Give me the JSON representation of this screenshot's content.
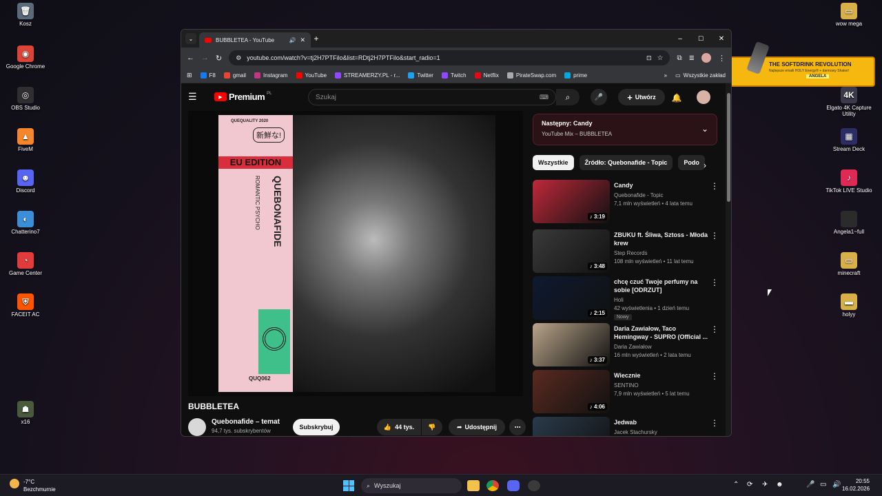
{
  "desktop": {
    "left_icons": [
      {
        "label": "Kosz",
        "color": "#5b6b7a",
        "glyph": "🗑"
      },
      {
        "label": "Google Chrome",
        "color": "#db4437",
        "glyph": "◉"
      },
      {
        "label": "OBS Studio",
        "color": "#302e31",
        "glyph": "◎"
      },
      {
        "label": "FiveM",
        "color": "#f5862b",
        "glyph": "▲"
      },
      {
        "label": "Discord",
        "color": "#5865f2",
        "glyph": "☻"
      },
      {
        "label": "Chatterino7",
        "color": "#3a8fd8",
        "glyph": "◐"
      },
      {
        "label": "Game Center",
        "color": "#e23b3b",
        "glyph": "◔"
      },
      {
        "label": "FACEIT AC",
        "color": "#ff5500",
        "glyph": "⛨"
      },
      {
        "label": "x16",
        "color": "#4a5a3c",
        "glyph": "☗"
      }
    ],
    "right_icons": [
      {
        "label": "wow mega",
        "color": "#d8b04a",
        "glyph": "▭"
      },
      {
        "label": "Elgato 4K Capture Utility",
        "color": "#3a3a4a",
        "glyph": "4K"
      },
      {
        "label": "Stream Deck",
        "color": "#2d2d66",
        "glyph": "▦"
      },
      {
        "label": "TikTok LIVE Studio",
        "color": "#e02a56",
        "glyph": "♪"
      },
      {
        "label": "Angela1~full",
        "color": "#2b2b2b",
        "glyph": ""
      },
      {
        "label": "minecraft",
        "color": "#d8b04a",
        "glyph": "▭"
      },
      {
        "label": "holyy",
        "color": "#d8b04a",
        "glyph": "▬"
      }
    ],
    "promo": {
      "title": "THE SOFTDRINK REVOLUTION",
      "subtitle": "Najlepsze emaili HOLY Energy® + darmowy Shaker!",
      "name": "ANGELA"
    }
  },
  "browser": {
    "tab_title": "BUBBLETEA - YouTube",
    "url": "youtube.com/watch?v=tj2H7PTFilo&list=RDtj2H7PTFilo&start_radio=1",
    "bookmarks": [
      {
        "label": "F8",
        "color": "#1877f2"
      },
      {
        "label": "gmail",
        "color": "#ea4335"
      },
      {
        "label": "Instagram",
        "color": "#c13584"
      },
      {
        "label": "YouTube",
        "color": "#ff0000"
      },
      {
        "label": "STREAMERZY.PL - r...",
        "color": "#9146ff"
      },
      {
        "label": "Twitter",
        "color": "#1da1f2"
      },
      {
        "label": "Twitch",
        "color": "#9146ff"
      },
      {
        "label": "Netflix",
        "color": "#e50914"
      },
      {
        "label": "PirateSwap.com",
        "color": "#aaaaaa"
      },
      {
        "label": "prime",
        "color": "#00a8e1"
      }
    ],
    "all_bookmarks": "Wszystkie zakład"
  },
  "youtube": {
    "logo": "Premium",
    "logo_sup": "PL",
    "search_placeholder": "Szukaj",
    "create_label": "Utwórz",
    "video_title": "BUBBLETEA",
    "channel_name": "Quebonafide – temat",
    "subscribers": "94,7 tys. subskrybentów",
    "subscribe_label": "Subskrybuj",
    "likes": "44 tys.",
    "share_label": "Udostępnij",
    "cover": {
      "edition": "EU EDITION",
      "quality": "QUEQUALITY 2020",
      "badge": "新鮮な!",
      "artist": "QUEBONAFIDE",
      "romantic": "ROMANTIC PSYCHO",
      "catalogue": "QUQ062"
    },
    "up_next": {
      "label": "Następny: Candy",
      "sub": "YouTube Mix – BUBBLETEA"
    },
    "chips": [
      "Wszystkie",
      "Źródło: Quebonafide - Topic",
      "Podo"
    ],
    "videos": [
      {
        "title": "Candy",
        "channel": "Quebonafide - Topic",
        "meta": "7,1 mln wyświetleń • 4 lata temu",
        "duration": "3:19",
        "music": true,
        "thumb": "#c0283a"
      },
      {
        "title": "ZBUKU ft. Śliwa, Sztoss - Młoda krew",
        "channel": "Step Records",
        "meta": "108 mln wyświetleń • 11 lat temu",
        "duration": "3:48",
        "music": true,
        "thumb": "#3a3a3a"
      },
      {
        "title": "chcę czuć Twoje perfumy na sobie [ODRZUT]",
        "channel": "Holi",
        "meta": "42 wyświetlenia • 1 dzień temu",
        "duration": "2:15",
        "badge": "Nowy",
        "music": true,
        "thumb": "#0e1a30"
      },
      {
        "title": "Daria Zawiałow, Taco Hemingway - SUPRO (Official ...",
        "channel": "Daria Zawiałow",
        "meta": "16 mln wyświetleń • 2 lata temu",
        "duration": "3:37",
        "music": true,
        "thumb": "#b9a58a"
      },
      {
        "title": "Wiecznie",
        "channel": "SENTINO",
        "meta": "7,9 mln wyświetleń • 5 lat temu",
        "duration": "4:06",
        "music": true,
        "thumb": "#5a2a20"
      },
      {
        "title": "Jedwab",
        "channel": "Jacek Stachursky",
        "meta": "",
        "duration": "",
        "music": false,
        "thumb": "#2a3a4a"
      }
    ]
  },
  "taskbar": {
    "weather_temp": "-7°C",
    "weather_desc": "Bezchmurnie",
    "search_label": "Wyszukaj",
    "time": "20:55",
    "date": "16.02.2026"
  }
}
